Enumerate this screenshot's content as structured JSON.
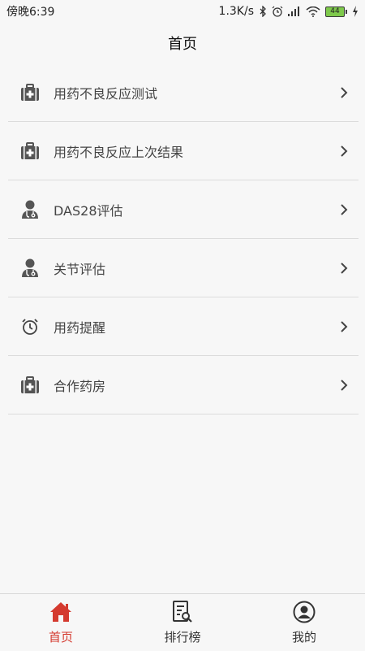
{
  "status_bar": {
    "time": "傍晚6:39",
    "network_speed": "1.3K/s",
    "battery_level": "44",
    "icons": [
      "bluetooth-icon",
      "alarm-icon",
      "signal-icon",
      "wifi-icon",
      "battery-icon",
      "charging-icon"
    ]
  },
  "header": {
    "title": "首页"
  },
  "menu": {
    "items": [
      {
        "label": "用药不良反应测试",
        "icon": "medical-kit-icon"
      },
      {
        "label": "用药不良反应上次结果",
        "icon": "medical-kit-icon"
      },
      {
        "label": "DAS28评估",
        "icon": "doctor-icon"
      },
      {
        "label": "关节评估",
        "icon": "doctor-icon"
      },
      {
        "label": "用药提醒",
        "icon": "alarm-clock-icon"
      },
      {
        "label": "合作药房",
        "icon": "medical-kit-icon"
      }
    ]
  },
  "tab_bar": {
    "tabs": [
      {
        "label": "首页",
        "icon": "home-icon",
        "active": true
      },
      {
        "label": "排行榜",
        "icon": "ranking-list-icon",
        "active": false
      },
      {
        "label": "我的",
        "icon": "user-icon",
        "active": false
      }
    ],
    "active_color": "#d43a2f"
  },
  "colors": {
    "icon": "#555555",
    "accent": "#d43a2f"
  }
}
